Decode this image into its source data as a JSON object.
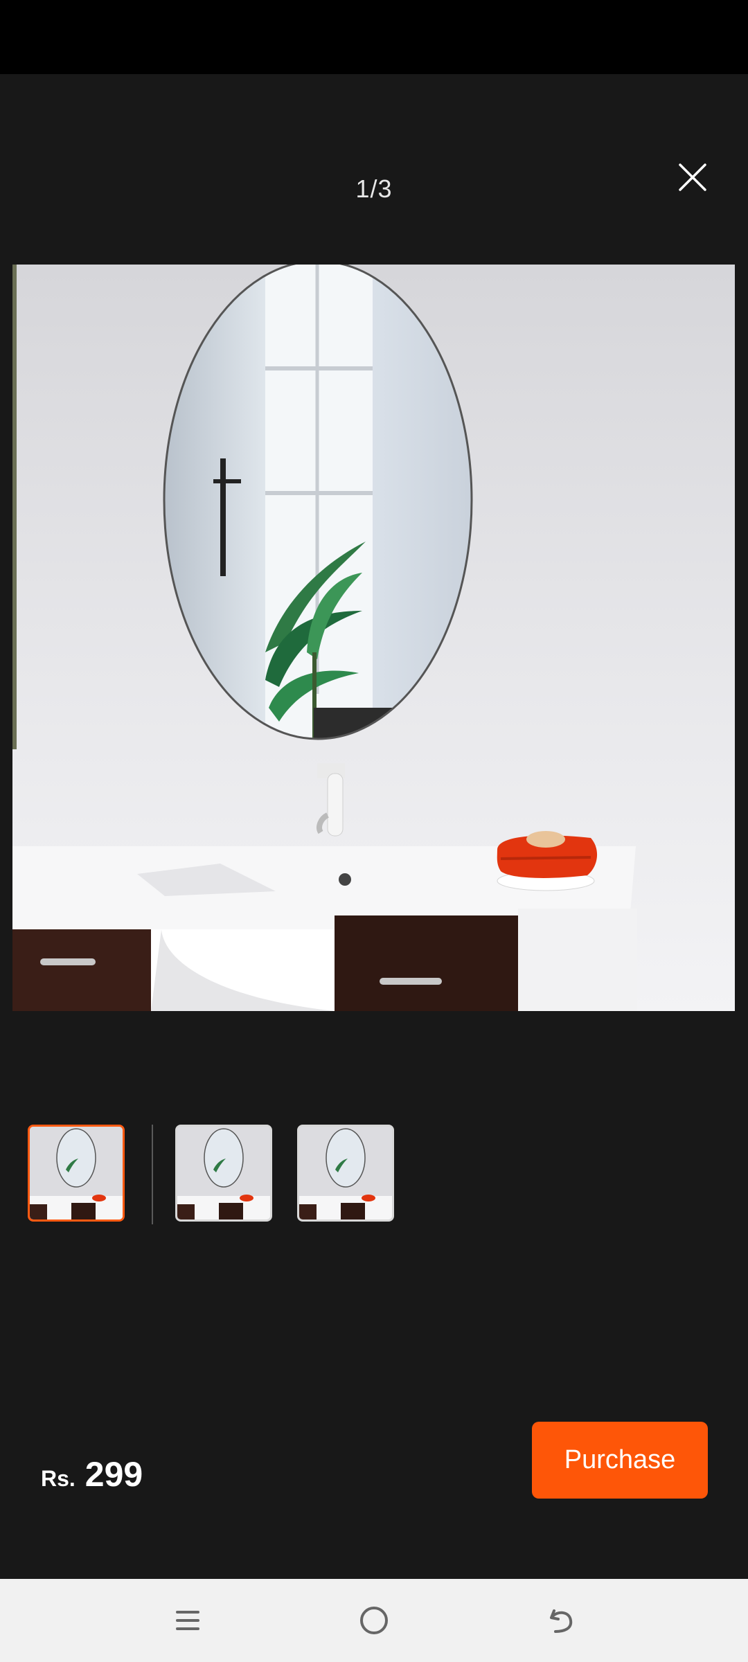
{
  "viewer": {
    "counter": "1/3",
    "close_icon": "close-icon"
  },
  "product": {
    "image_subject": "oval bathroom mirror",
    "thumbnails": [
      {
        "index": 1,
        "selected": true
      },
      {
        "index": 2,
        "selected": false
      },
      {
        "index": 3,
        "selected": false
      }
    ]
  },
  "footer": {
    "currency": "Rs.",
    "price": "299",
    "purchase_label": "Purchase"
  },
  "nav": {
    "menu_icon": "menu-icon",
    "home_icon": "home-icon",
    "back_icon": "back-icon"
  },
  "colors": {
    "accent": "#fe5608",
    "background": "#181818",
    "status_bar": "#000000",
    "nav_bar": "#f1f1f1"
  }
}
